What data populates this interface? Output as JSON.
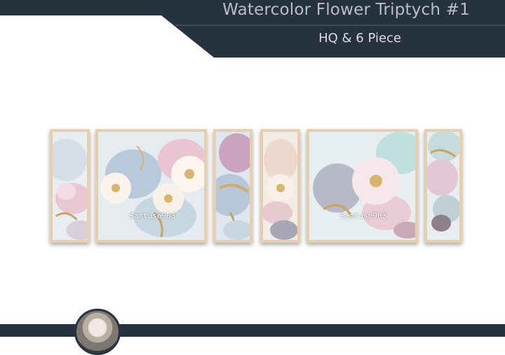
{
  "header": {
    "title": "Watercolor Flower Triptych #1",
    "subtitle": "HQ & 6 Piece"
  },
  "panels": [
    {
      "name": "panel-1",
      "watermark": ""
    },
    {
      "name": "panel-2",
      "watermark": "Samtuse963"
    },
    {
      "name": "panel-3",
      "watermark": ""
    },
    {
      "name": "panel-4",
      "watermark": ""
    },
    {
      "name": "panel-5",
      "watermark": "Samtuse963"
    },
    {
      "name": "panel-6",
      "watermark": ""
    }
  ],
  "colors": {
    "banner": "#263240",
    "frame": "#e6cfae"
  },
  "avatar": {
    "icon": "doll-avatar-icon"
  }
}
